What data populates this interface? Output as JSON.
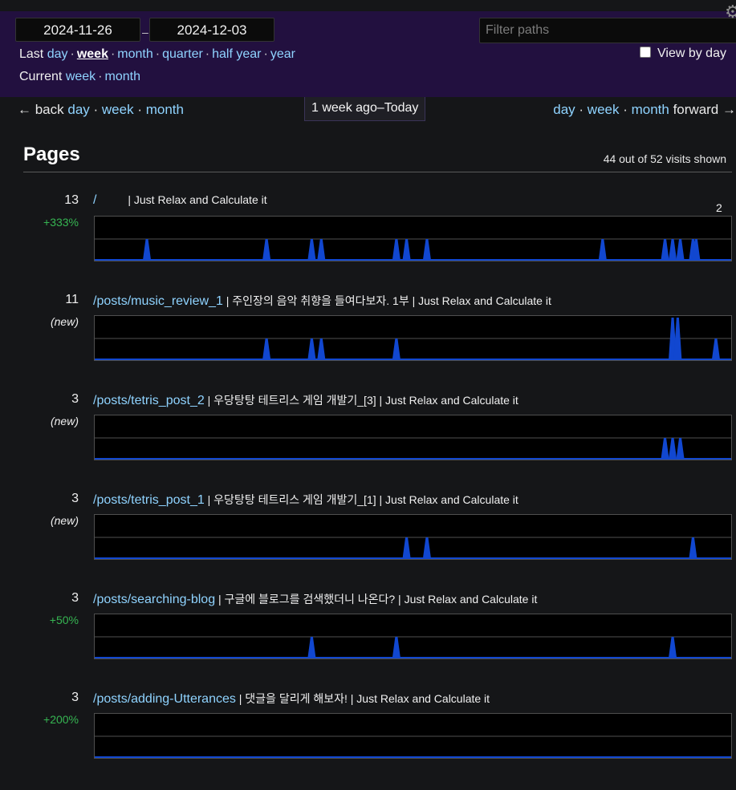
{
  "header": {
    "start_date": "2024-11-26",
    "end_date": "2024-12-03",
    "dash": "–",
    "last_label": "Last",
    "last_options": [
      "day",
      "week",
      "month",
      "quarter",
      "half year",
      "year"
    ],
    "last_active": "week",
    "current_label": "Current",
    "current_options": [
      "week",
      "month"
    ],
    "filter_placeholder": "Filter paths",
    "view_by_day_label": "View by day",
    "view_by_day_checked": false,
    "settings_icon": "gear-icon"
  },
  "nav": {
    "back_label": "← back",
    "back_options": [
      "day",
      "week",
      "month"
    ],
    "period_label": "1 week ago–Today",
    "forward_options": [
      "day",
      "week",
      "month"
    ],
    "forward_label": "forward →"
  },
  "pages": {
    "heading": "Pages",
    "shown_text": "44 out of 52 visits shown",
    "max_label": "2",
    "accent_color": "#1147d0",
    "rows": [
      {
        "count": "13",
        "change": "+333%",
        "change_type": "up",
        "path": "/",
        "title": "          | Just Relax and Calculate it",
        "spikes": [
          {
            "x": 0.082,
            "h": 1
          },
          {
            "x": 0.27,
            "h": 1
          },
          {
            "x": 0.341,
            "h": 1
          },
          {
            "x": 0.356,
            "h": 1
          },
          {
            "x": 0.474,
            "h": 1
          },
          {
            "x": 0.49,
            "h": 1
          },
          {
            "x": 0.522,
            "h": 1
          },
          {
            "x": 0.798,
            "h": 1
          },
          {
            "x": 0.896,
            "h": 1
          },
          {
            "x": 0.908,
            "h": 1
          },
          {
            "x": 0.92,
            "h": 1
          },
          {
            "x": 0.94,
            "h": 1
          },
          {
            "x": 0.945,
            "h": 1
          }
        ]
      },
      {
        "count": "11",
        "change": "(new)",
        "change_type": "new",
        "path": "/posts/music_review_1",
        "title": " | 주인장의 음악 취향을 들여다보자. 1부 | Just Relax and Calculate it",
        "spikes": [
          {
            "x": 0.27,
            "h": 1
          },
          {
            "x": 0.341,
            "h": 1
          },
          {
            "x": 0.356,
            "h": 1
          },
          {
            "x": 0.474,
            "h": 1
          },
          {
            "x": 0.908,
            "h": 2
          },
          {
            "x": 0.916,
            "h": 2
          },
          {
            "x": 0.976,
            "h": 1
          }
        ]
      },
      {
        "count": "3",
        "change": "(new)",
        "change_type": "new",
        "path": "/posts/tetris_post_2",
        "title": " | 우당탕탕 테트리스 게임 개발기_[3] | Just Relax and Calculate it",
        "spikes": [
          {
            "x": 0.896,
            "h": 1
          },
          {
            "x": 0.908,
            "h": 1
          },
          {
            "x": 0.92,
            "h": 1
          }
        ]
      },
      {
        "count": "3",
        "change": "(new)",
        "change_type": "new",
        "path": "/posts/tetris_post_1",
        "title": " | 우당탕탕 테트리스 게임 개발기_[1] | Just Relax and Calculate it",
        "spikes": [
          {
            "x": 0.49,
            "h": 1
          },
          {
            "x": 0.522,
            "h": 1
          },
          {
            "x": 0.94,
            "h": 1
          }
        ]
      },
      {
        "count": "3",
        "change": "+50%",
        "change_type": "up",
        "path": "/posts/searching-blog",
        "title": " | 구글에 블로그를 검색했더니 나온다? | Just Relax and Calculate it",
        "spikes": [
          {
            "x": 0.341,
            "h": 1
          },
          {
            "x": 0.474,
            "h": 1
          },
          {
            "x": 0.908,
            "h": 1
          }
        ]
      },
      {
        "count": "3",
        "change": "+200%",
        "change_type": "up",
        "path": "/posts/adding-Utterances",
        "title": " | 댓글을 달리게 해보자! | Just Relax and Calculate it",
        "spikes": []
      }
    ]
  }
}
